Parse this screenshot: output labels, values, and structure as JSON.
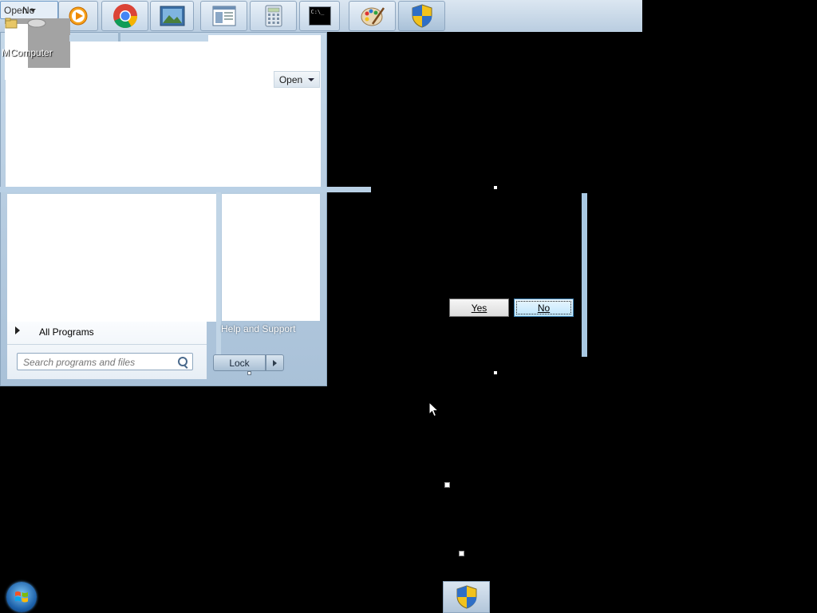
{
  "taskbar_top": {
    "open_dropdown_label": "Open",
    "no_label": "No",
    "buttons": [
      {
        "name": "media-player-icon"
      },
      {
        "name": "chrome-icon"
      },
      {
        "name": "image-viewer-icon"
      },
      {
        "name": "document-window-icon"
      },
      {
        "name": "calculator-icon"
      },
      {
        "name": "command-prompt-icon",
        "text": "C:\\_"
      },
      {
        "name": "paint-icon"
      },
      {
        "name": "uac-shield-icon"
      }
    ]
  },
  "desktop": {
    "computer_label": "Computer",
    "computer_label_prefix": "M"
  },
  "start_menu": {
    "open_button_label": "Open",
    "all_programs_label": "All Programs",
    "search_placeholder": "Search programs and files",
    "help_label": "Help and Support",
    "lock_label": "Lock"
  },
  "dialog": {
    "yes_label": "Yes",
    "no_label": "No"
  },
  "colors": {
    "desktop": "#000000",
    "menu_bg": "#b9cde0",
    "accent": "#3c7fb1"
  }
}
